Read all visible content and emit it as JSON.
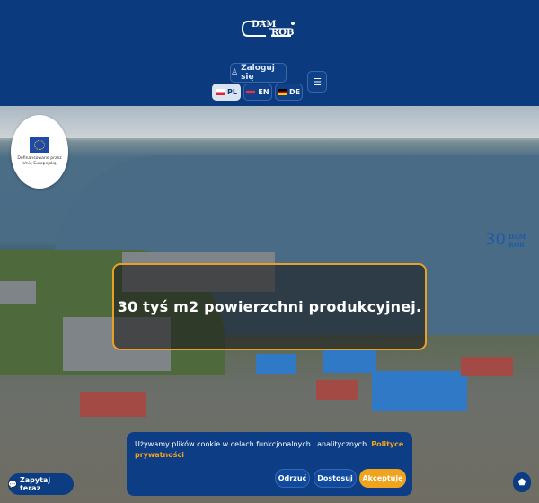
{
  "header": {
    "logo": {
      "top": "DAM",
      "bottom": "ROB"
    },
    "login_label": "Zaloguj się",
    "menu_icon": "menu-icon",
    "languages": [
      {
        "code": "PL",
        "active": true
      },
      {
        "code": "EN",
        "active": false
      },
      {
        "code": "DE",
        "active": false
      }
    ]
  },
  "eu": {
    "text": "Dofinansowane przez Unię Europejską"
  },
  "hero": {
    "number": "30",
    "logo": "DAM ROB",
    "headline": "30 tyś m2 powierzchni produkcyjnej."
  },
  "cookie": {
    "text": "Używamy plików cookie w celach funkcjonalnych i analitycznych.",
    "link": "Polityce prywatności",
    "reject_label": "Odrzuć",
    "customize_label": "Dostosuj",
    "accept_label": "Akceptuję"
  },
  "chat": {
    "label": "Zapytaj teraz"
  },
  "colors": {
    "header": "#0b3b7e",
    "accent": "#f0a31d"
  }
}
